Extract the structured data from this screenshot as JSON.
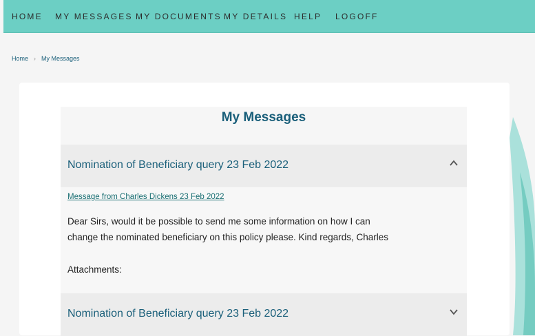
{
  "nav": {
    "items": [
      "HOME",
      "MY MESSAGES",
      "MY DOCUMENTS",
      "MY DETAILS",
      "HELP",
      "LOGOFF"
    ]
  },
  "breadcrumb": {
    "home": "Home",
    "separator": "›",
    "current": "My Messages"
  },
  "page": {
    "title": "My Messages"
  },
  "messages": [
    {
      "subject": "Nomination of Beneficiary query 23 Feb 2022",
      "expanded": true,
      "from_link": "Message from Charles Dickens 23 Feb 2022",
      "body": "Dear Sirs, would it be possible to send me some information on how I can change the nominated beneficiary on this policy please. Kind regards, Charles",
      "attachments_label": "Attachments:",
      "chevron": "chevron-up-icon"
    },
    {
      "subject": "Nomination of Beneficiary query 23 Feb 2022",
      "expanded": false,
      "chevron": "chevron-down-icon"
    }
  ],
  "colors": {
    "nav_bg": "#6ccfc4",
    "accent_text": "#1a5f7a",
    "link": "#1a6f73"
  }
}
